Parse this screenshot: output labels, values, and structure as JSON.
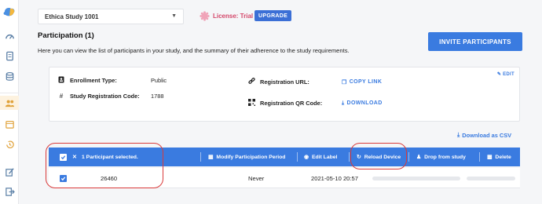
{
  "study": {
    "name": "Ethica Study 1001"
  },
  "license": {
    "text": "License: Trial",
    "upgrade_label": "UPGRADE"
  },
  "page": {
    "title": "Participation (1)",
    "description": "Here you can view the list of participants in your study, and the summary of their adherence to the study requirements.",
    "invite_label": "INVITE PARTICIPANTS"
  },
  "info_card": {
    "edit_label": "EDIT",
    "enrollment_type_label": "Enrollment Type:",
    "enrollment_type_value": "Public",
    "registration_code_label": "Study Registration Code:",
    "registration_code_value": "1788",
    "registration_url_label": "Registration URL:",
    "copy_link_label": "COPY LINK",
    "qr_code_label": "Registration QR Code:",
    "download_label": "DOWNLOAD"
  },
  "download_csv_label": "Download as CSV",
  "toolbar": {
    "selected_text": "1 Participant selected.",
    "modify_period_label": "Modify Participation Period",
    "edit_label_label": "Edit Label",
    "reload_device_label": "Reload Device",
    "drop_label": "Drop from study",
    "delete_label": "Delete"
  },
  "rows": [
    {
      "id": "26460",
      "period": "Never",
      "date": "2021-05-10 20:57"
    }
  ],
  "colors": {
    "accent": "#3a7be0",
    "annotation": "#d93a3a",
    "license": "#d4476a"
  }
}
